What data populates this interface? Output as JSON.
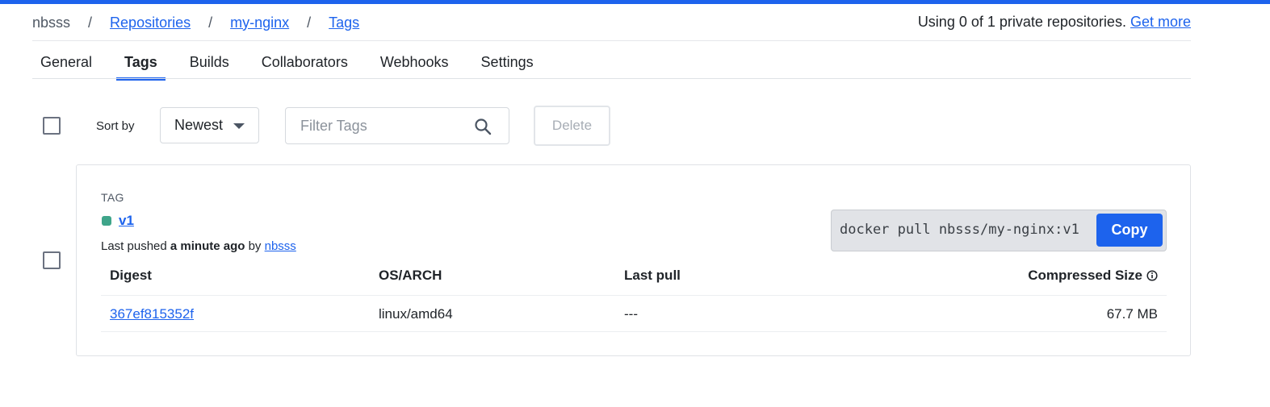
{
  "accent_color": "#1d63ed",
  "breadcrumb": {
    "root": "nbsss",
    "sep": "/",
    "repositories": "Repositories",
    "repo": "my-nginx",
    "current": "Tags"
  },
  "usage": {
    "text": "Using 0 of 1 private repositories.",
    "link": "Get more"
  },
  "tabs": [
    {
      "label": "General",
      "active": false
    },
    {
      "label": "Tags",
      "active": true
    },
    {
      "label": "Builds",
      "active": false
    },
    {
      "label": "Collaborators",
      "active": false
    },
    {
      "label": "Webhooks",
      "active": false
    },
    {
      "label": "Settings",
      "active": false
    }
  ],
  "toolbar": {
    "sort_label": "Sort by",
    "sort_value": "Newest",
    "filter_placeholder": "Filter Tags",
    "delete_label": "Delete"
  },
  "tag_card": {
    "heading": "TAG",
    "tag_name": "v1",
    "status_color": "#3fa58a",
    "pushed_prefix": "Last pushed",
    "pushed_time": "a minute ago",
    "pushed_by_word": "by",
    "pushed_by": "nbsss",
    "pull_command": "docker pull nbsss/my-nginx:v1",
    "copy_label": "Copy",
    "columns": {
      "digest": "Digest",
      "os_arch": "OS/ARCH",
      "last_pull": "Last pull",
      "size": "Compressed Size"
    },
    "rows": [
      {
        "digest": "367ef815352f",
        "os_arch": "linux/amd64",
        "last_pull": "---",
        "size": "67.7 MB"
      }
    ]
  }
}
